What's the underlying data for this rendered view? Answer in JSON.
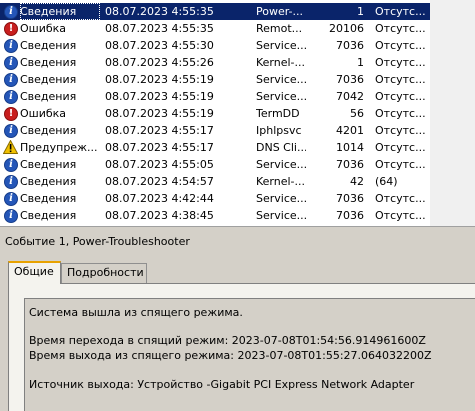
{
  "events": [
    {
      "type": "info",
      "level": "Сведения",
      "date": "08.07.2023 4:55:35",
      "source": "Power-...",
      "id": "1",
      "task": "Отсутс...",
      "selected": true
    },
    {
      "type": "error",
      "level": "Ошибка",
      "date": "08.07.2023 4:55:35",
      "source": "Remot...",
      "id": "20106",
      "task": "Отсутс...",
      "selected": false
    },
    {
      "type": "info",
      "level": "Сведения",
      "date": "08.07.2023 4:55:30",
      "source": "Service...",
      "id": "7036",
      "task": "Отсутс...",
      "selected": false
    },
    {
      "type": "info",
      "level": "Сведения",
      "date": "08.07.2023 4:55:26",
      "source": "Kernel-...",
      "id": "1",
      "task": "Отсутс...",
      "selected": false
    },
    {
      "type": "info",
      "level": "Сведения",
      "date": "08.07.2023 4:55:19",
      "source": "Service...",
      "id": "7036",
      "task": "Отсутс...",
      "selected": false
    },
    {
      "type": "info",
      "level": "Сведения",
      "date": "08.07.2023 4:55:19",
      "source": "Service...",
      "id": "7042",
      "task": "Отсутс...",
      "selected": false
    },
    {
      "type": "error",
      "level": "Ошибка",
      "date": "08.07.2023 4:55:19",
      "source": "TermDD",
      "id": "56",
      "task": "Отсутс...",
      "selected": false
    },
    {
      "type": "info",
      "level": "Сведения",
      "date": "08.07.2023 4:55:17",
      "source": "Iphlpsvc",
      "id": "4201",
      "task": "Отсутс...",
      "selected": false
    },
    {
      "type": "warning",
      "level": "Предупреж...",
      "date": "08.07.2023 4:55:17",
      "source": "DNS Cli...",
      "id": "1014",
      "task": "Отсутс...",
      "selected": false
    },
    {
      "type": "info",
      "level": "Сведения",
      "date": "08.07.2023 4:55:05",
      "source": "Service...",
      "id": "7036",
      "task": "Отсутс...",
      "selected": false
    },
    {
      "type": "info",
      "level": "Сведения",
      "date": "08.07.2023 4:54:57",
      "source": "Kernel-...",
      "id": "42",
      "task": "(64)",
      "selected": false
    },
    {
      "type": "info",
      "level": "Сведения",
      "date": "08.07.2023 4:42:44",
      "source": "Service...",
      "id": "7036",
      "task": "Отсутс...",
      "selected": false
    },
    {
      "type": "info",
      "level": "Сведения",
      "date": "08.07.2023 4:38:45",
      "source": "Service...",
      "id": "7036",
      "task": "Отсутс...",
      "selected": false
    }
  ],
  "details": {
    "title": "Событие 1, Power-Troubleshooter",
    "tabs": [
      "Общие",
      "Подробности"
    ],
    "active_tab": "Общие",
    "message": {
      "line1": "Система вышла из спящего режима.",
      "line2": "Время перехода в спящий режим: 2023-07-08T01:54:56.914961600Z",
      "line3": "Время выхода из спящего режима: 2023-07-08T01:55:27.064032200Z",
      "line4": "Источник выхода: Устройство -Gigabit PCI Express Network Adapter"
    }
  },
  "icons": {
    "info": "info-icon",
    "error": "error-icon",
    "warning": "warning-icon"
  },
  "colors": {
    "selection": "#0a246a",
    "info": "#2456b8",
    "error": "#c81e1e",
    "warning": "#f0c000",
    "panel": "#d4d0c8"
  }
}
